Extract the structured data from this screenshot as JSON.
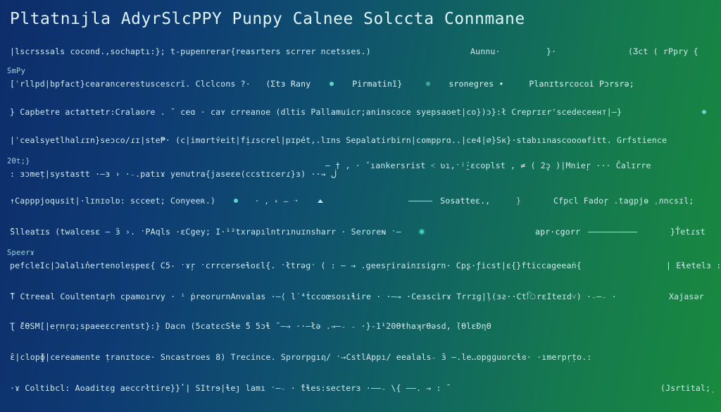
{
  "title": "Pltatnıjla  AdyrSlcPPY  Punpy Calnee Solccta Connmane",
  "row1": {
    "left": "|lscrsssals cocond.,sochaptı:}; t-pupenrerar{reasrters scrrer ncetsses.)",
    "a": "Aunnu·",
    "b": "}·",
    "c": "(Ӡct  ( rPpry {"
  },
  "lblA": "SmPy",
  "row2": {
    "left": "[ˈrllpd|bpfact}cearancerestuscescrї. Clclcons ?·",
    "a": "(Σtɜ  Rany",
    "b": "Pirmatinȉ}",
    "c": "sronegres  •",
    "d": "Planɪtsrcocoі  Pɔrsrǝ;"
  },
  "row3": {
    "left": "} Capbetre actattetr:Cralaore . ˘   ceɑ · caʏ  crreanoe  (dltis  Pallamuicr;aninscocе  syepsaoet|co})ɔ}:ł  Creprɪɛr'scedeceент|—}"
  },
  "row4": {
    "left": "|ˈcealsyetlhalɾɪn}seɔco/ɾɪ|ste₱· (c|imɑrtʏ́eit|fịɾscrel|pɪpét,.lɪns  Sepalatirbirn|compprɑ..|cе4|⌀}Sĸ}·stabıınascoooɵfitt. Grfstience"
  },
  "lblB": "2Θt;}",
  "row5": {
    "left": ": ɜɔmeṭ|systastt ·—ɜ › ·₋.patıɤ yenutra{jaseɛe(ccstɪсеrɾ}ɜ)    ··→  ڶ",
    "a": "– †  , · ˇıankersrist  ˂  ʋı,ˑʲ̱́·ɛcoplst  ,   ≠   (  2̥ɔ  )|Mnieŗ ···  Čalɪrre"
  },
  "row6": {
    "left": "↑Capppjoqusit|·lɪnɪolɒ:  scceet;  Conyeeʀ.)",
    "mid": "·  ‹  – ·  →",
    "a": "Sosatteɛ.,",
    "b": "Cfpcl  Fadoŗ  .tagpjɵ      ˌлncsɪl;"
  },
  "row7": {
    "left": " ̑Slleatɪs (twalcesɛ  — ̑ɜ    ›.   ˑPAqls     ·ɛCgey;    I·¹²txrapılntrınuɪnsharr ·    Seroreɴ     ˑ—",
    "a": "apr·cgorr",
    "b": "}T̾etɾst"
  },
  "lblC": "Speerɤ",
  "row8": {
    "left": "pefcleIc|Ɔalalın̾ertenoleṣpeɛ{  C5- ˑɤŗ  ˑcrrcerseɬoɛl{. ˑłtrəg̛  ( :  —    →  .geesŗirainɪsigrn·    Cpʂ·ƒicst|ɛ{}fticcageeaṅ{",
    "a": "|  Eɬetelɜ :"
  },
  "row9": {
    "left": " ̑T Ctreeal Coultentaŗh cpamoırvy · ⁱ  ṗreorurnAnvalas  ·–⟨   l˙⁴ṫccoœsosıɬire  · ·—→   ·Ceɜscìrɤ   Trrɪg|ḷ(ɜƨ··CtিrɛIteɪd˅)    ·₋—₋   ·",
    "a": "Xajasər"
  },
  "row10": {
    "left": "Ʈ  ̑ɛ̋ӨSM[|eṛnṛɑ;spaeeɛcrentst}:}   Dacn    (5catɛcSɬe       ̑5  5ɔɬ           ˘–→     ··–łə       .→—₋    ₋  ·}-1¹20ӨŧhaʞrӨəsd, ̀(ӨlɛÐƞΘ"
  },
  "row11": {
    "left": " ̑ɛ|clopɸ|cereamente ṭranɪtocе·   Sncastroes 8)  Trecince.   Sprorpgıฤ/  ˑ→CstlAppı/   eealals₋ ̑ɜ   –.leꓺopgɡuorcɬɞ·      ·ımerpṛṭo.:"
  },
  "row12": {
    "left": "·ɤ Coltibcl: Aoaditɛg аeccrłtire}}̓   |  SItrɘ|ɬeȷ   lamı   ˑ—₋ ·  ̑tɬes:secterɜ    ·–—₋     \\{   ——. → :    ̑",
    "a": "(Jsrtital;̣"
  }
}
